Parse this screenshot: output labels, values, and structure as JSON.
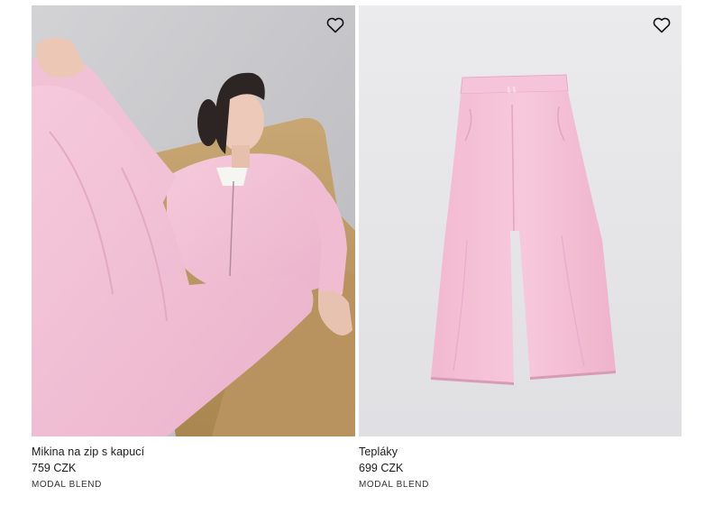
{
  "products": [
    {
      "name": "Mikina na zip s kapucí",
      "price": "759 CZK",
      "tag": "MODAL BLEND",
      "wishlist_icon": "heart-outline-icon",
      "image": "model-pink-zip-hoodie-photo"
    },
    {
      "name": "Tepláky",
      "price": "699 CZK",
      "tag": "MODAL BLEND",
      "wishlist_icon": "heart-outline-icon",
      "image": "pink-wide-leg-sweatpants-photo"
    }
  ],
  "colors": {
    "product_pink": "#f4bfd6",
    "photo_bg_left": "#c9c9cc",
    "photo_bg_right": "#e7e7e9"
  }
}
